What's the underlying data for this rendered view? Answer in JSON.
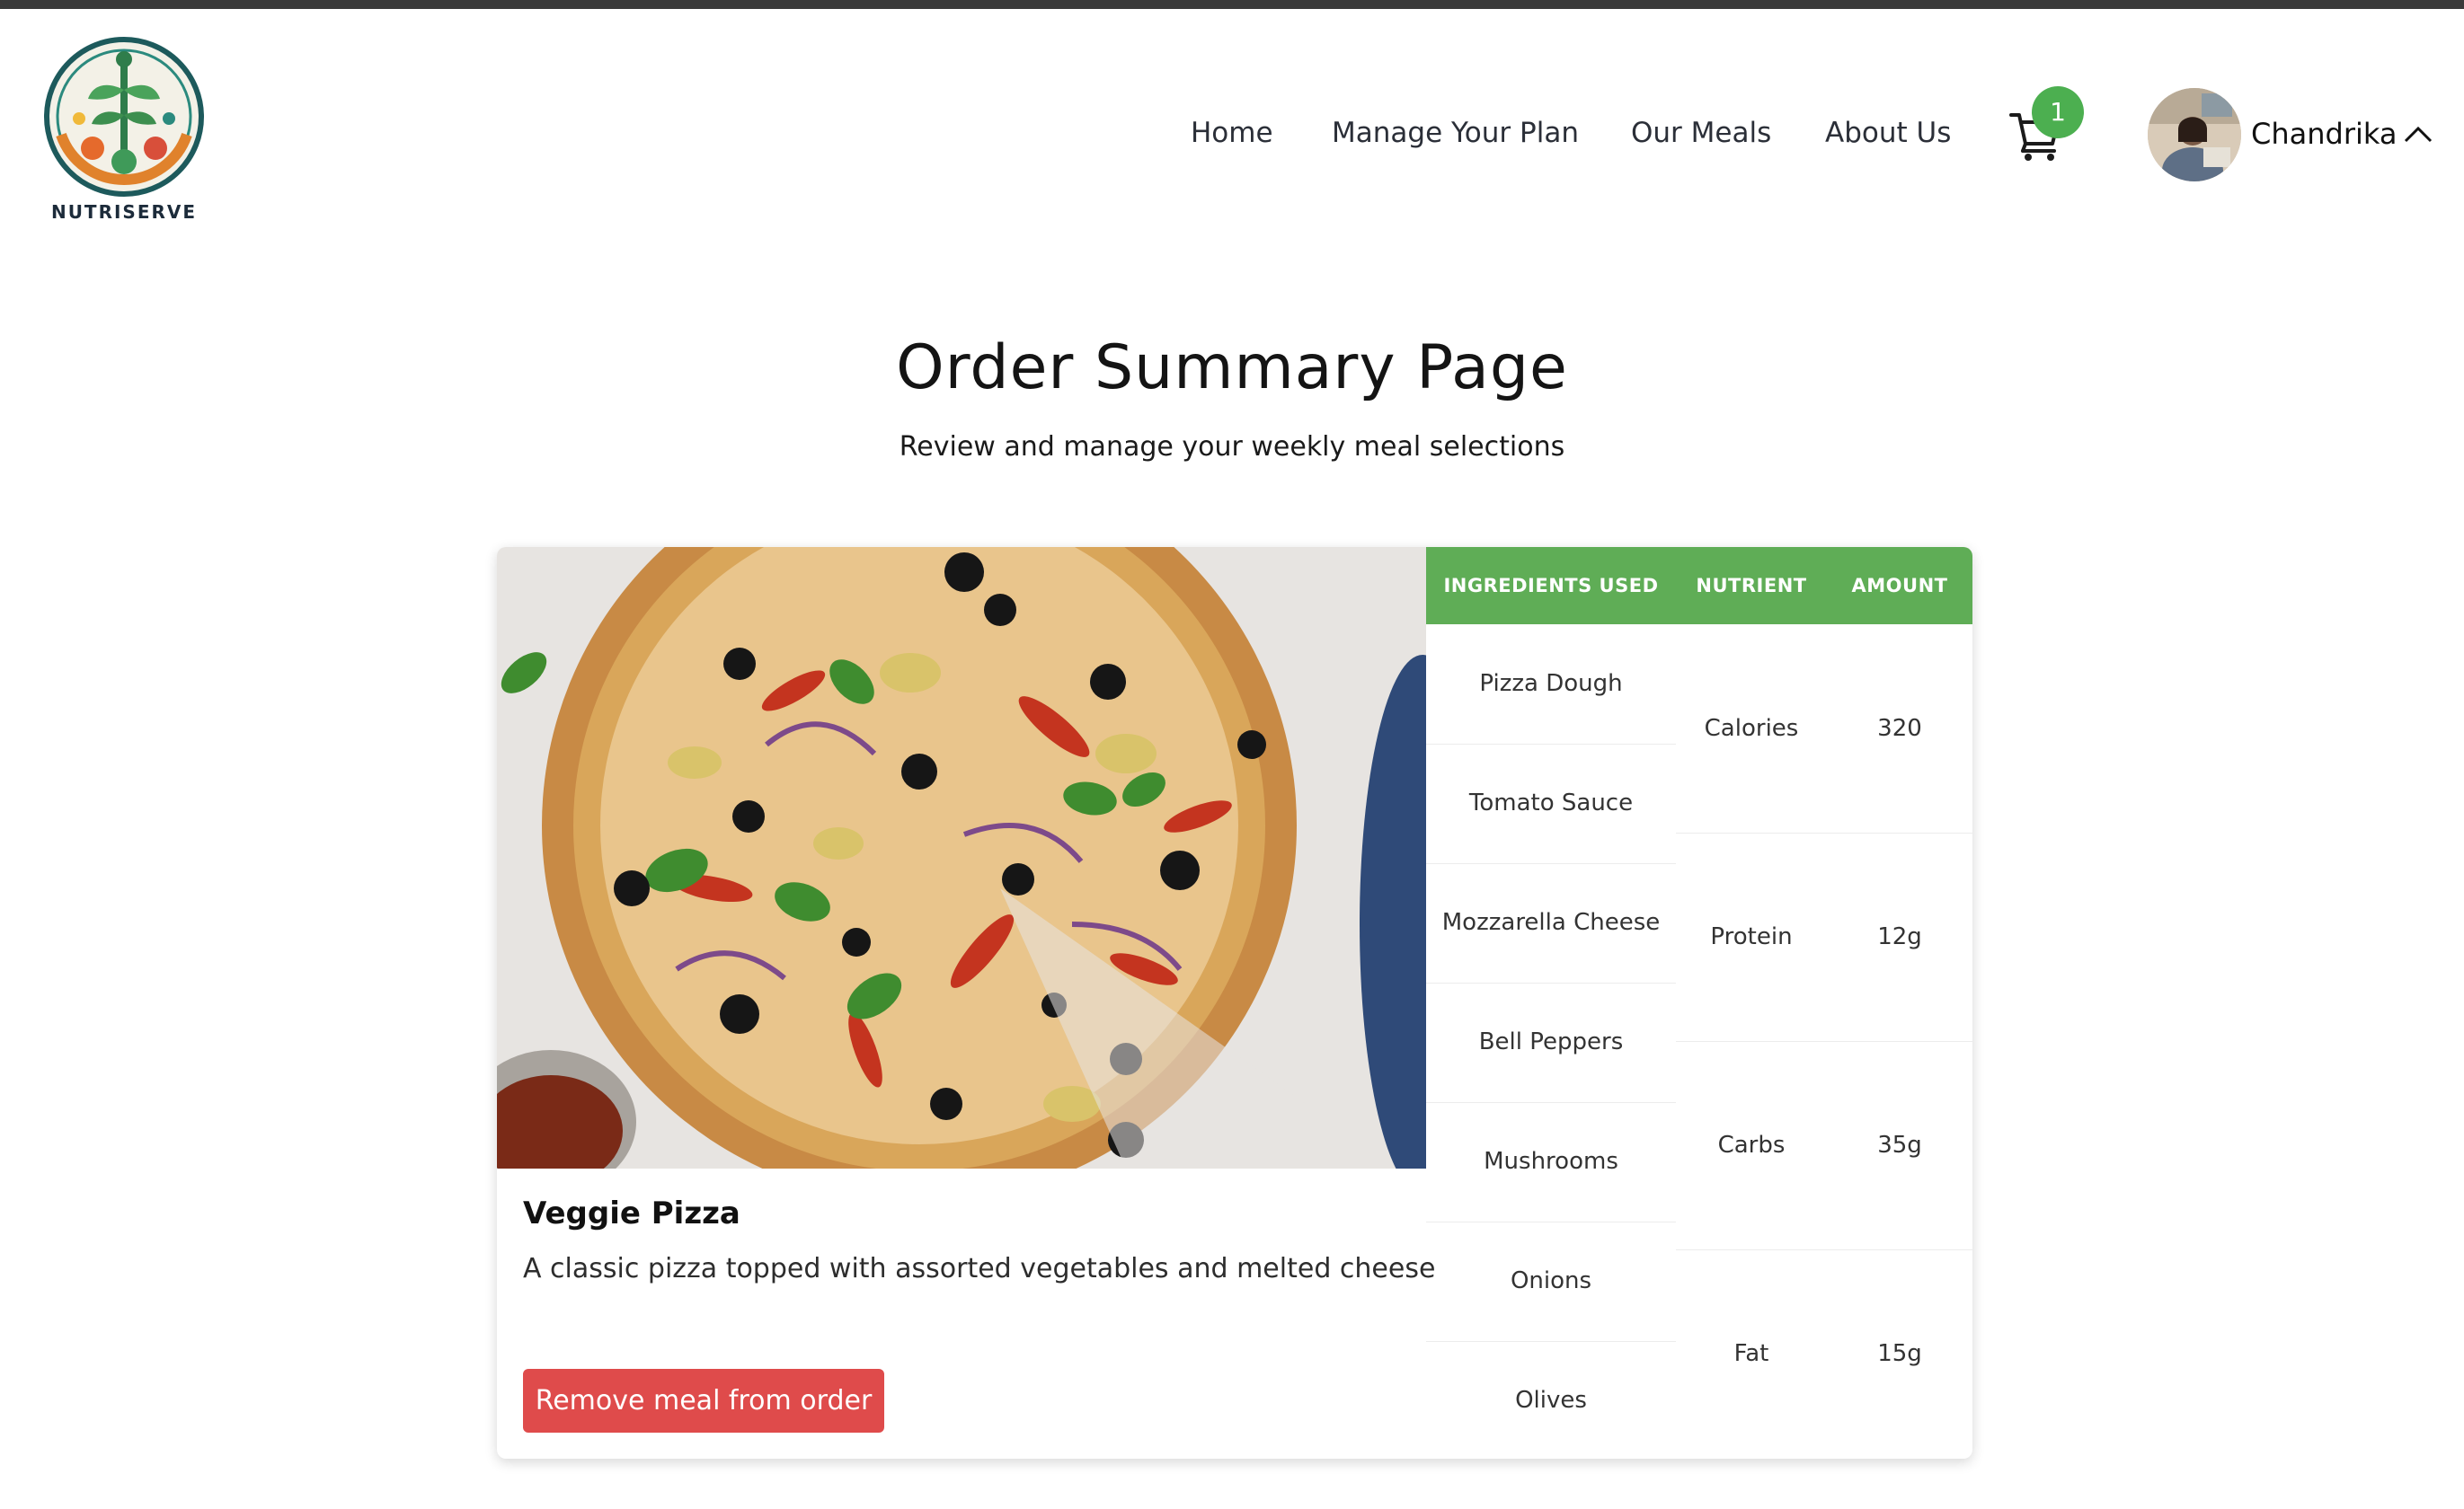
{
  "brand": {
    "name": "NUTRISERVE"
  },
  "nav": {
    "items": [
      {
        "label": "Home"
      },
      {
        "label": "Manage Your Plan"
      },
      {
        "label": "Our Meals"
      },
      {
        "label": "About Us"
      }
    ]
  },
  "cart": {
    "count": "1",
    "icon": "cart-icon"
  },
  "user": {
    "name": "Chandrika",
    "caret_icon": "chevron-up-icon"
  },
  "page": {
    "title": "Order Summary Page",
    "subtitle": "Review and manage your weekly meal selections"
  },
  "meal": {
    "name": "Veggie Pizza",
    "description": "A classic pizza topped with assorted vegetables and melted cheese",
    "remove_label": "Remove meal from order"
  },
  "table": {
    "headers": {
      "ingredients": "INGREDIENTS USED",
      "nutrient": "NUTRIENT",
      "amount": "AMOUNT"
    },
    "ingredients": [
      "Pizza Dough",
      "Tomato Sauce",
      "Mozzarella Cheese",
      "Bell Peppers",
      "Mushrooms",
      "Onions",
      "Olives"
    ],
    "nutrients": [
      {
        "name": "Calories",
        "amount": "320"
      },
      {
        "name": "Protein",
        "amount": "12g"
      },
      {
        "name": "Carbs",
        "amount": "35g"
      },
      {
        "name": "Fat",
        "amount": "15g"
      }
    ]
  },
  "colors": {
    "accent_green": "#5fad56",
    "badge_green": "#4caf50",
    "remove_red": "#df4b4b",
    "top_bar": "#3a3a3a"
  }
}
